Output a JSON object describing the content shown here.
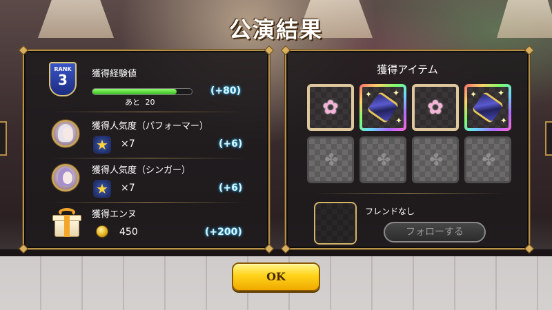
{
  "title": "公演結果",
  "results": {
    "rank": {
      "label": "RANK",
      "value": "3"
    },
    "experience": {
      "label": "獲得経験値",
      "remaining_label": "あと",
      "remaining_value": "20",
      "progress_fraction": 0.85,
      "gain": "(+80)"
    },
    "performer_popularity": {
      "label": "獲得人気度（パフォーマー）",
      "count": "×7",
      "gain": "(+6)"
    },
    "singer_popularity": {
      "label": "獲得人気度（シンガー）",
      "count": "×7",
      "gain": "(+6)"
    },
    "ennu": {
      "label": "獲得エンヌ",
      "amount": "450",
      "gain": "(+200)"
    }
  },
  "items": {
    "title": "獲得アイテム",
    "slots": [
      {
        "state": "got",
        "icon": "flower-icon"
      },
      {
        "state": "rainbow",
        "icon": "ribbon-icon"
      },
      {
        "state": "got",
        "icon": "flower-icon"
      },
      {
        "state": "rainbow",
        "icon": "ribbon-icon"
      },
      {
        "state": "empty",
        "icon": "paw-icon"
      },
      {
        "state": "empty",
        "icon": "paw-icon"
      },
      {
        "state": "empty",
        "icon": "paw-icon"
      },
      {
        "state": "empty",
        "icon": "paw-icon"
      }
    ]
  },
  "friend": {
    "status": "フレンドなし",
    "follow_label": "フォローする"
  },
  "ok_label": "OK",
  "colors": {
    "gain_glow": "#2aa6e0",
    "frame_gold": "#b8914a",
    "exp_bar": "#3cbb25",
    "ok_button": "#ffd31a"
  }
}
